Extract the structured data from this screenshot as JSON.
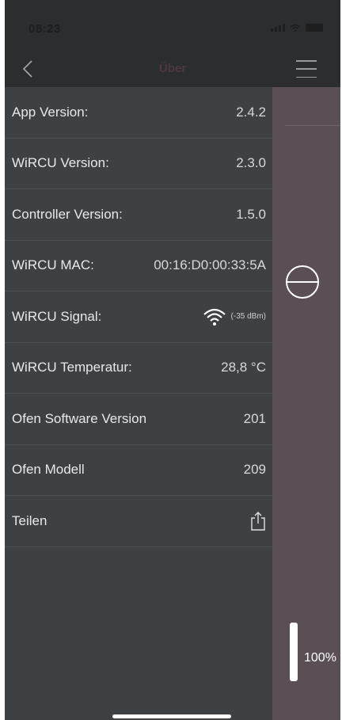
{
  "status_bar": {
    "time": "08:23"
  },
  "nav": {
    "title": "Über",
    "back_icon": "chevron-left-icon",
    "menu_icon": "hamburger-menu-icon"
  },
  "info": {
    "app_version_label": "App Version:",
    "app_version": "2.4.2",
    "wircu_version_label": "WiRCU Version:",
    "wircu_version": "2.3.0",
    "controller_version_label": "Controller Version:",
    "controller_version": "1.5.0",
    "wircu_mac_label": "WiRCU MAC:",
    "wircu_mac": "00:16:D0:00:33:5A",
    "wircu_signal_label": "WiRCU Signal:",
    "wircu_signal_dbm": "(-35 dBm)",
    "wircu_temp_label": "WiRCU Temperatur:",
    "wircu_temp": "28,8 °C",
    "oven_sw_label": "Ofen Software Version",
    "oven_sw": "201",
    "oven_model_label": "Ofen Modell",
    "oven_model": "209",
    "share_label": "Teilen",
    "share_icon": "share-icon"
  },
  "side_panel": {
    "level_percent": "100%",
    "level_fraction": 1.0,
    "minus_icon": "minus-circle-icon"
  },
  "colors": {
    "panel_bg": "#3d4143",
    "side_bg": "#5b4f56",
    "bar_bg": "#2b2d2f"
  }
}
